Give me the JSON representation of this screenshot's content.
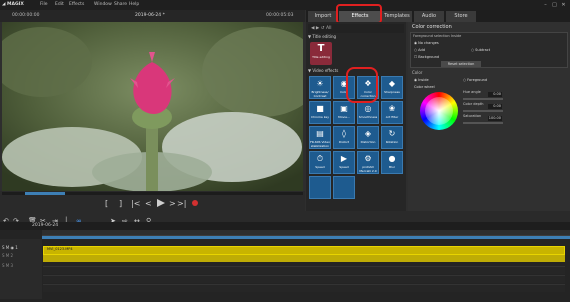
{
  "menubar": {
    "logo": "◢ MAGIX",
    "items": [
      "File",
      "Edit",
      "Effects",
      "Window",
      "Share",
      "Help"
    ]
  },
  "preview": {
    "left_time": "00:00:00:00",
    "title": "2019-06-24 *",
    "right_time": "00:00:05:03"
  },
  "tabs": [
    "Import",
    "Effects",
    "Templates",
    "Audio",
    "Store"
  ],
  "effects_panel": {
    "title_editing": "Title editing",
    "title_tile": "Title editing",
    "video_effects": "Video effects",
    "tiles": [
      "Brightness/ Contrast",
      "Color",
      "Color correction",
      "Sharpness",
      "Chroma key",
      "Movie...",
      "Smoothness",
      "Art filter",
      "FR-60S Video stabilization",
      "Distort",
      "Distortion",
      "Rotation",
      "Speed",
      "Speed",
      "proDAD Mercalli 2.0",
      "Blur"
    ]
  },
  "settings": {
    "title": "Color correction",
    "correction_mode_label": "Foreground selection Inside",
    "opts": [
      "No changes",
      "Add",
      "Subtract",
      "Background"
    ],
    "reset_label": "Reset selection",
    "color_label": "Color",
    "mode_opts": [
      "Inside",
      "Foreground"
    ],
    "color_wheel_label": "Color wheel",
    "sliders": [
      {
        "label": "Hue angle",
        "value": "0.00"
      },
      {
        "label": "Color depth",
        "value": "0.00"
      },
      {
        "label": "Saturation",
        "value": "100.00"
      }
    ]
  },
  "timeline": {
    "date": "2019-06-24",
    "clip_label": "MVI_0123.MP4"
  }
}
